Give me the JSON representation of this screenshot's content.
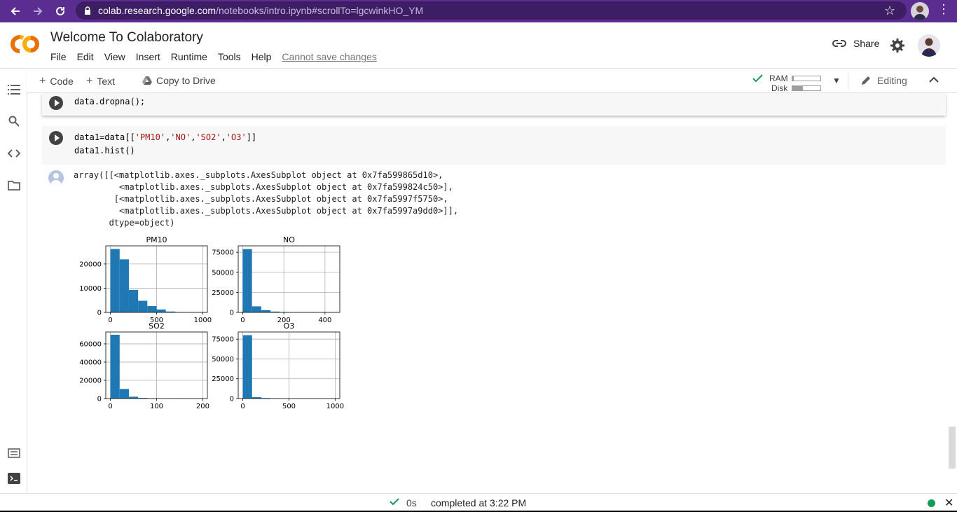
{
  "browser": {
    "url_host": "colab.research.google.com",
    "url_path": "/notebooks/intro.ipynb#scrollTo=lgcwinkHO_YM"
  },
  "header": {
    "title": "Welcome To Colaboratory",
    "menu": [
      "File",
      "Edit",
      "View",
      "Insert",
      "Runtime",
      "Tools",
      "Help"
    ],
    "save_notice": "Cannot save changes",
    "share_label": "Share"
  },
  "toolbar": {
    "code_label": "Code",
    "text_label": "Text",
    "copy_label": "Copy to Drive",
    "ram_label": "RAM",
    "disk_label": "Disk",
    "ram_usage": 0.05,
    "disk_usage": 0.38,
    "editing_label": "Editing"
  },
  "cells": {
    "cell1": {
      "code": "data.dropna();"
    },
    "cell2": {
      "line1_pre": "data1=data[[",
      "s1": "'PM10'",
      "s2": "'NO'",
      "s3": "'SO2'",
      "s4": "'O3'",
      "line1_post": "]]",
      "line2": "data1.hist()"
    },
    "output_text": "array([[<matplotlib.axes._subplots.AxesSubplot object at 0x7fa599865d10>,\n         <matplotlib.axes._subplots.AxesSubplot object at 0x7fa599824c50>],\n        [<matplotlib.axes._subplots.AxesSubplot object at 0x7fa5997f5750>,\n         <matplotlib.axes._subplots.AxesSubplot object at 0x7fa5997a9dd0>]],\n       dtype=object)"
  },
  "chart_data": [
    {
      "type": "bar",
      "title": "PM10",
      "bin_edges": [
        0,
        100,
        200,
        300,
        400,
        500,
        600,
        700,
        800,
        900,
        1000
      ],
      "values": [
        26200,
        21900,
        9300,
        4800,
        2600,
        1200,
        350,
        100,
        40,
        15
      ],
      "xlim": [
        -50,
        1050
      ],
      "ylim": [
        0,
        27500
      ],
      "xticks": [
        "0",
        "500",
        "1000"
      ],
      "xtick_values": [
        0,
        500,
        1000
      ],
      "yticks": [
        "0",
        "10000",
        "20000"
      ],
      "ytick_values": [
        0,
        10000,
        20000
      ],
      "grid": true
    },
    {
      "type": "bar",
      "title": "NO",
      "bin_edges": [
        0,
        45,
        90,
        135,
        180,
        225,
        270,
        315,
        360,
        405,
        450
      ],
      "values": [
        79000,
        7500,
        2800,
        1000,
        400,
        150,
        60,
        30,
        10,
        5
      ],
      "xlim": [
        -22,
        472
      ],
      "ylim": [
        0,
        83000
      ],
      "xticks": [
        "0",
        "200",
        "400"
      ],
      "xtick_values": [
        0,
        200,
        400
      ],
      "yticks": [
        "0",
        "25000",
        "50000",
        "75000"
      ],
      "ytick_values": [
        0,
        25000,
        50000,
        75000
      ],
      "grid": true
    },
    {
      "type": "bar",
      "title": "SO2",
      "bin_edges": [
        0,
        20,
        40,
        60,
        80,
        100,
        120,
        140,
        160,
        180,
        200
      ],
      "values": [
        70000,
        10500,
        2000,
        700,
        200,
        80,
        30,
        10,
        5,
        2
      ],
      "xlim": [
        -10,
        210
      ],
      "ylim": [
        0,
        73000
      ],
      "xticks": [
        "0",
        "100",
        "200"
      ],
      "xtick_values": [
        0,
        100,
        200
      ],
      "yticks": [
        "0",
        "20000",
        "40000",
        "60000"
      ],
      "ytick_values": [
        0,
        20000,
        40000,
        60000
      ],
      "grid": true
    },
    {
      "type": "bar",
      "title": "O3",
      "bin_edges": [
        0,
        100,
        200,
        300,
        400,
        500,
        600,
        700,
        800,
        900,
        1000
      ],
      "values": [
        80000,
        1700,
        700,
        150,
        50,
        20,
        10,
        5,
        2,
        1
      ],
      "xlim": [
        -50,
        1050
      ],
      "ylim": [
        0,
        84000
      ],
      "xticks": [
        "0",
        "500",
        "1000"
      ],
      "xtick_values": [
        0,
        500,
        1000
      ],
      "yticks": [
        "0",
        "25000",
        "50000",
        "75000"
      ],
      "ytick_values": [
        0,
        25000,
        50000,
        75000
      ],
      "grid": true
    }
  ],
  "status": {
    "duration": "0s",
    "completed": "completed at 3:22 PM"
  },
  "colors": {
    "browser_bar": "#5c2d91",
    "bar_fill": "#1f77b4",
    "status_ok": "#0f9d58"
  }
}
